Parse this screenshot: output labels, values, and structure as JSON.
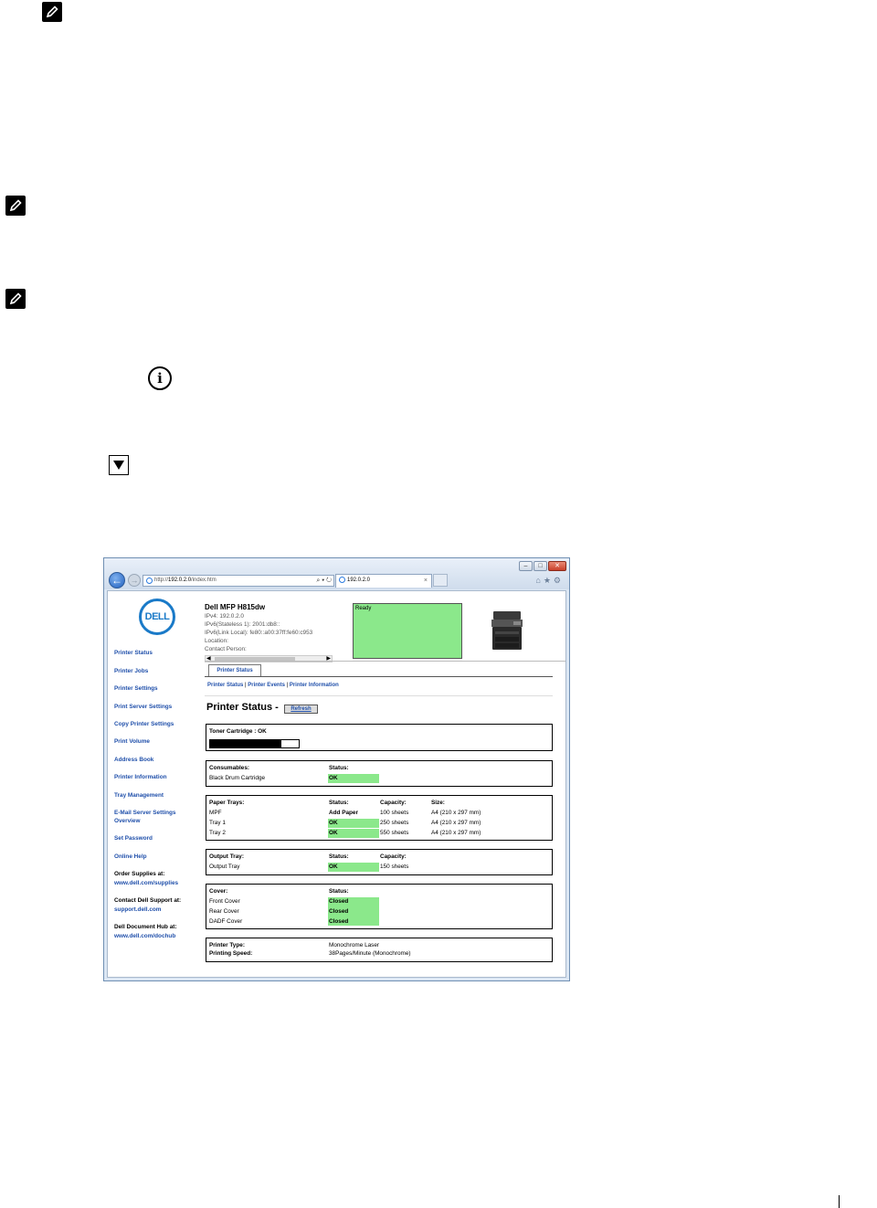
{
  "browser": {
    "url_prefix": "http://",
    "url_host": "192.0.2.0",
    "url_path": "/index.htm",
    "address_tools": "⌕ ▾ ↻",
    "tab_title": "192.0.2.0",
    "tab_close": "×",
    "window_buttons": [
      "–",
      "□",
      "✕"
    ],
    "command_icons": "⌂★⚙"
  },
  "nav": {
    "logo_text": "DELL",
    "items": [
      "Printer Status",
      "Printer Jobs",
      "Printer Settings",
      "Print Server Settings",
      "Copy Printer Settings",
      "Print Volume",
      "Address Book",
      "Printer Information",
      "Tray Management",
      "E-Mail Server Settings",
      "Overview",
      "Set Password",
      "Online Help"
    ],
    "order_label": "Order Supplies at:",
    "order_link": "www.dell.com/supplies",
    "support_label": "Contact Dell Support at:",
    "support_link": "support.dell.com",
    "hub_label": "Dell Document Hub at:",
    "hub_link": "www.dell.com/dochub"
  },
  "header": {
    "title": "Dell MFP H815dw",
    "lines": [
      "IPv4: 192.0.2.0",
      "IPv6(Stateless 1): 2001:db8::",
      "IPv6(Link Local): fe80::a00:37ff:fe60:c953",
      "Location:",
      "Contact Person:"
    ],
    "status_text": "Ready"
  },
  "tabs": {
    "active": "Printer Status"
  },
  "sublinks": [
    "Printer Status",
    "Printer Events",
    "Printer Information"
  ],
  "sublink_sep": "|",
  "page": {
    "heading": "Printer Status -",
    "refresh_label": "Refresh"
  },
  "toner": {
    "label": "Toner Cartridge : OK",
    "level": 0.8
  },
  "consumables": {
    "header": "Consumables:",
    "status_header": "Status:",
    "item": "Black Drum Cartridge",
    "status": "OK"
  },
  "paper_trays": {
    "header": "Paper Trays:",
    "status_header": "Status:",
    "capacity_header": "Capacity:",
    "size_header": "Size:",
    "rows": [
      {
        "name": "MPF",
        "status": "Add Paper",
        "capacity": "100 sheets",
        "size": "A4 (210 x 297 mm)"
      },
      {
        "name": "Tray 1",
        "status": "OK",
        "capacity": "250 sheets",
        "size": "A4 (210 x 297 mm)"
      },
      {
        "name": "Tray 2",
        "status": "OK",
        "capacity": "550 sheets",
        "size": "A4 (210 x 297 mm)"
      }
    ]
  },
  "output_tray": {
    "header": "Output Tray:",
    "status_header": "Status:",
    "capacity_header": "Capacity:",
    "name": "Output Tray",
    "status": "OK",
    "capacity": "150 sheets"
  },
  "cover": {
    "header": "Cover:",
    "status_header": "Status:",
    "rows": [
      {
        "name": "Front Cover",
        "status": "Closed"
      },
      {
        "name": "Rear Cover",
        "status": "Closed"
      },
      {
        "name": "DADF Cover",
        "status": "Closed"
      }
    ]
  },
  "printer_info": {
    "type_label": "Printer Type:",
    "type_value": "Monochrome Laser",
    "speed_label": "Printing Speed:",
    "speed_value": "38Pages/Minute (Monochrome)"
  },
  "colors": {
    "ok_green": "#8be88b",
    "link_blue": "#1f4faa",
    "dell_blue": "#1a7ac8"
  }
}
